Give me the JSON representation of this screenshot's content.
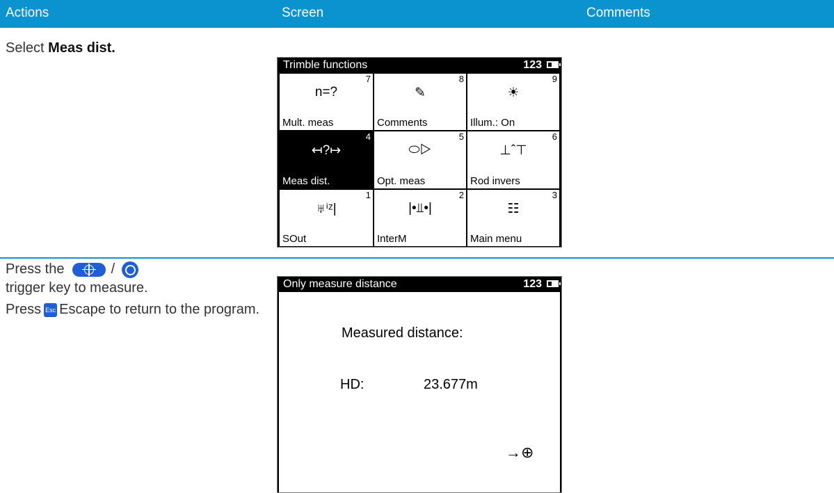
{
  "header": {
    "col_actions": "Actions",
    "col_screen": "Screen",
    "col_comments": "Comments"
  },
  "row1": {
    "action_prefix": "Select ",
    "action_bold": "Meas dist.",
    "screen": {
      "title": "Trimble functions",
      "indicator": "123",
      "cells": [
        {
          "num": "7",
          "icon": "n=?",
          "label": "Mult. meas"
        },
        {
          "num": "8",
          "icon": "✎",
          "label": "Comments"
        },
        {
          "num": "9",
          "icon": "☀",
          "label": "Illum.: On"
        },
        {
          "num": "4",
          "icon": "↤?↦",
          "label": "Meas dist."
        },
        {
          "num": "5",
          "icon": "⬭▷",
          "label": "Opt. meas"
        },
        {
          "num": "6",
          "icon": "⊥ˆ⊤",
          "label": "Rod invers"
        },
        {
          "num": "1",
          "icon": "♅ⁱᶻ|",
          "label": "SOut"
        },
        {
          "num": "2",
          "icon": "|•⫫•|",
          "label": "InterM"
        },
        {
          "num": "3",
          "icon": "☷",
          "label": "Main menu"
        }
      ],
      "selected_index": 3
    }
  },
  "row2": {
    "press_the": "Press the",
    "slash": "/",
    "trigger_text": "trigger key to measure.",
    "press": "Press",
    "esc_key": "Esc",
    "escape_text": "Escape to return to the program.",
    "screen": {
      "title": "Only measure distance",
      "indicator": "123",
      "measured_label": "Measured distance:",
      "hd_label": "HD:",
      "hd_value": "23.677m",
      "softkey": "→⊕"
    }
  },
  "colors": {
    "accent": "#0a93cf",
    "key_blue": "#1e5fd8"
  }
}
